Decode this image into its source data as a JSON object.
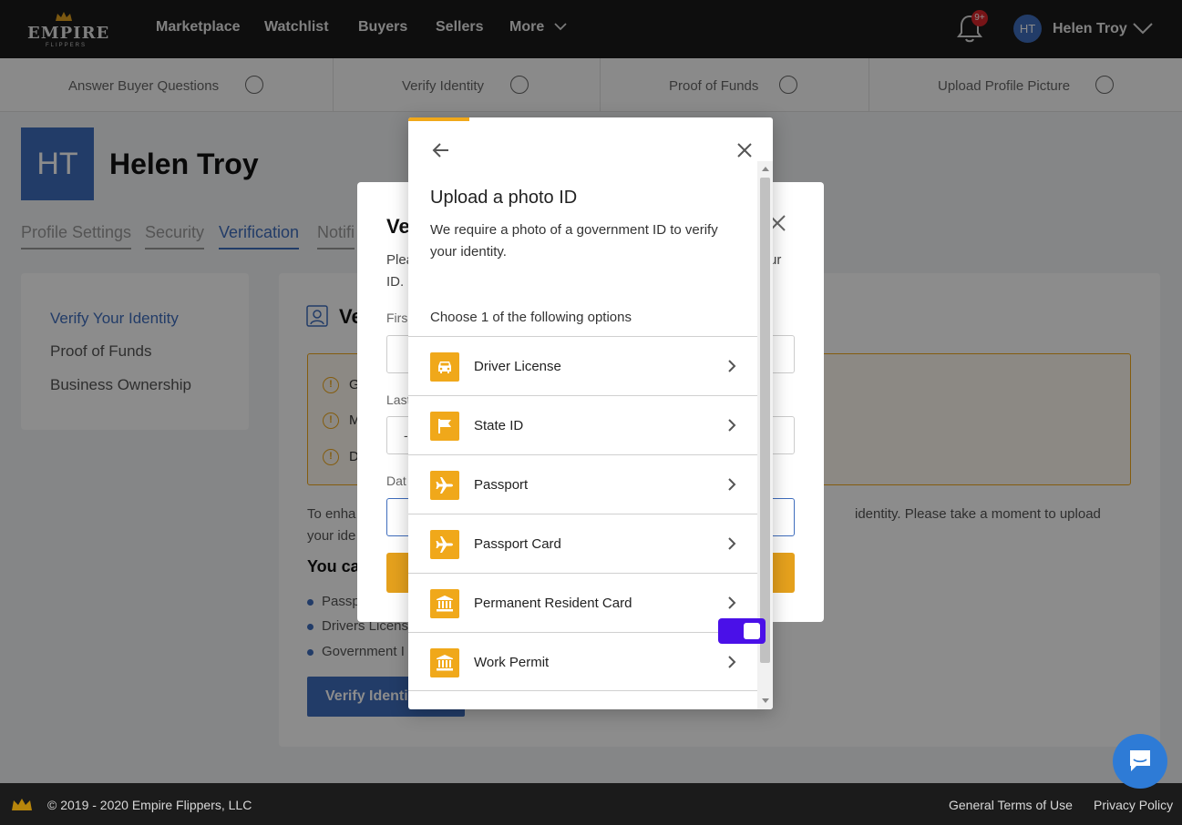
{
  "nav": {
    "logo_text": "EMPIRE",
    "logo_sub": "FLIPPERS",
    "links": [
      "Marketplace",
      "Watchlist",
      "Buyers",
      "Sellers",
      "More"
    ],
    "notification_count": "9+",
    "user_initials": "HT",
    "user_name": "Helen Troy"
  },
  "steps": [
    "Answer Buyer Questions",
    "Verify Identity",
    "Proof of Funds",
    "Upload Profile Picture"
  ],
  "profile": {
    "initials": "HT",
    "name": "Helen Troy",
    "tabs": [
      "Profile Settings",
      "Security",
      "Verification",
      "Notifi"
    ]
  },
  "side_menu": [
    "Verify Your Identity",
    "Proof of Funds",
    "Business Ownership"
  ],
  "main_card": {
    "title": "Ve",
    "alerts": [
      "G",
      "M",
      "D"
    ],
    "body_left_1": "To enha",
    "body_right_1": "identity. Please take a moment to upload",
    "body_left_2": "your ide",
    "subheading": "You ca",
    "bullets": [
      "Passp",
      "Drivers Licens",
      "Government I"
    ],
    "button": "Verify Identi"
  },
  "bg_modal": {
    "title": "Ve",
    "text_line1_left": "Plea",
    "text_line1_right": "ur",
    "text_line2_left": "ID.",
    "label_first": "Firs",
    "label_last": "Last",
    "last_value": "-",
    "label_date": "Dat"
  },
  "modal": {
    "title": "Upload a photo ID",
    "description": "We require a photo of a government ID to verify your identity.",
    "choose": "Choose 1 of the following options",
    "options": [
      {
        "label": "Driver License",
        "icon": "car-icon"
      },
      {
        "label": "State ID",
        "icon": "flag-icon"
      },
      {
        "label": "Passport",
        "icon": "airplane-icon"
      },
      {
        "label": "Passport Card",
        "icon": "airplane-icon"
      },
      {
        "label": "Permanent Resident Card",
        "icon": "bank-icon"
      },
      {
        "label": "Work Permit",
        "icon": "bank-icon"
      }
    ]
  },
  "footer": {
    "copyright": "© 2019 - 2020 Empire Flippers, LLC",
    "links": [
      "General Terms of Use",
      "Privacy Policy"
    ]
  },
  "colors": {
    "accent_orange": "#f0a81a",
    "brand_blue": "#3f6dbd",
    "toggle_purple": "#4a10e8",
    "chat_blue": "#2e7bd6"
  }
}
